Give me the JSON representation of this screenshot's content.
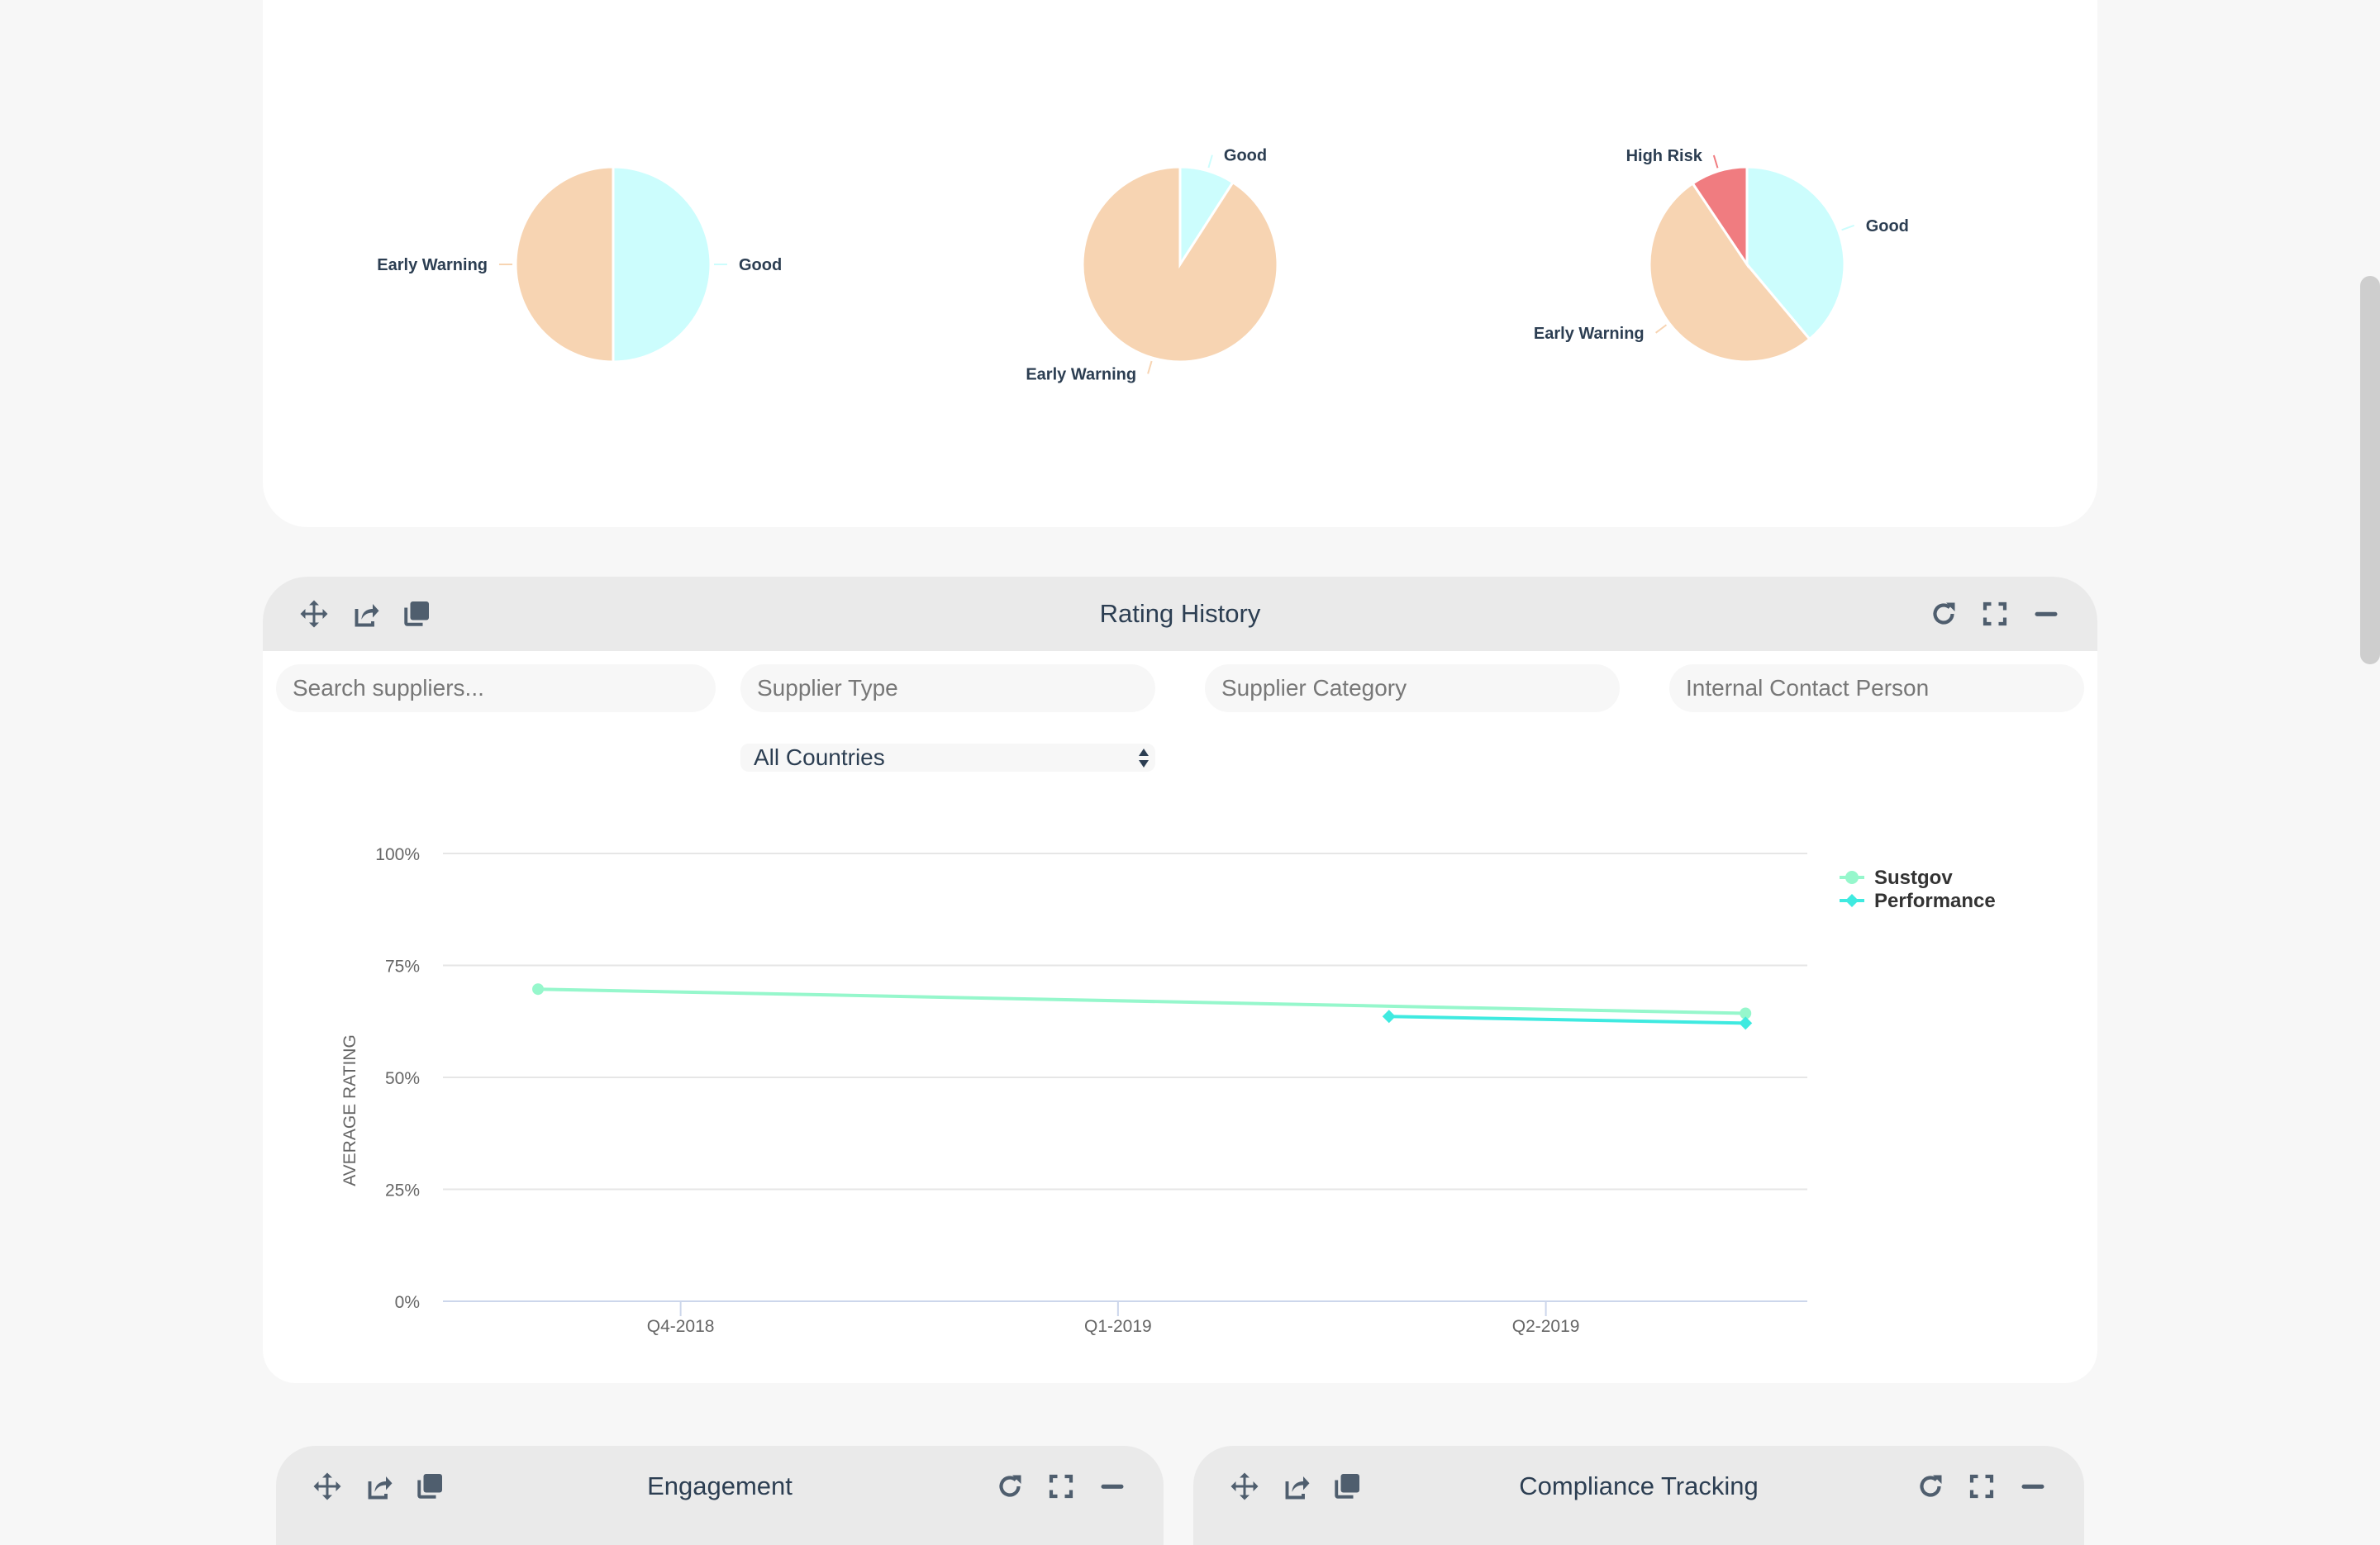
{
  "status_panel": {
    "pies": [
      {
        "slices": [
          {
            "label": "Good",
            "percent": 50.0,
            "color": "#ccfdfd"
          },
          {
            "label": "Early Warning",
            "percent": 50.0,
            "color": "#f7d4b2"
          }
        ]
      },
      {
        "slices": [
          {
            "label": "Good",
            "percent": 9.1,
            "color": "#ccfdfd"
          },
          {
            "label": "Early Warning",
            "percent": 90.9,
            "color": "#f7d4b2"
          }
        ]
      },
      {
        "slices": [
          {
            "label": "Good",
            "percent": 38.9,
            "color": "#ccfdfd"
          },
          {
            "label": "Early Warning",
            "percent": 51.7,
            "color": "#f7d4b2"
          },
          {
            "label": "High Risk",
            "percent": 9.4,
            "color": "#f07c80"
          }
        ]
      }
    ]
  },
  "rating_history": {
    "title": "Rating History",
    "header_icons_left": [
      "move-icon",
      "share-icon",
      "copy-icon"
    ],
    "header_icons_right": [
      "refresh-icon",
      "fullscreen-icon",
      "minimize-icon"
    ],
    "filters": {
      "search_placeholder": "Search suppliers...",
      "search_value": "",
      "supplier_type_placeholder": "Supplier Type",
      "supplier_category_placeholder": "Supplier Category",
      "internal_contact_placeholder": "Internal Contact Person",
      "country_selected": "All Countries"
    }
  },
  "chart_data": {
    "type": "line",
    "title": "",
    "xlabel": "",
    "ylabel": "AVERAGE RATING",
    "x_type": "datetime",
    "x_ticks": [
      {
        "label": "Q4-2018",
        "date": "2018-10-01"
      },
      {
        "label": "Q1-2019",
        "date": "2019-01-01"
      },
      {
        "label": "Q2-2019",
        "date": "2019-04-01"
      }
    ],
    "xlim": [
      "2018-08-12",
      "2019-05-26"
    ],
    "ylim": [
      0,
      100
    ],
    "y_ticks": [
      "0%",
      "25%",
      "50%",
      "75%",
      "100%"
    ],
    "y_tick_values": [
      0,
      25,
      50,
      75,
      100
    ],
    "grid": true,
    "legend_position": "top-right",
    "series": [
      {
        "name": "Sustgov",
        "color": "#96f7cc",
        "marker": "circle",
        "points": [
          {
            "x": "2018-09-01",
            "y": 69.7
          },
          {
            "x": "2019-05-13",
            "y": 64.3
          }
        ]
      },
      {
        "name": "Performance",
        "color": "#3feae0",
        "marker": "diamond",
        "points": [
          {
            "x": "2019-02-27",
            "y": 63.6
          },
          {
            "x": "2019-05-13",
            "y": 62.1
          }
        ]
      }
    ]
  },
  "bottom_panels": [
    {
      "title": "Engagement"
    },
    {
      "title": "Compliance Tracking"
    }
  ],
  "colors": {
    "page_bg": "#f7f7f7",
    "header_bg": "#eaeaea",
    "icon": "#4f5e6e",
    "text_dark": "#2c3e52"
  }
}
